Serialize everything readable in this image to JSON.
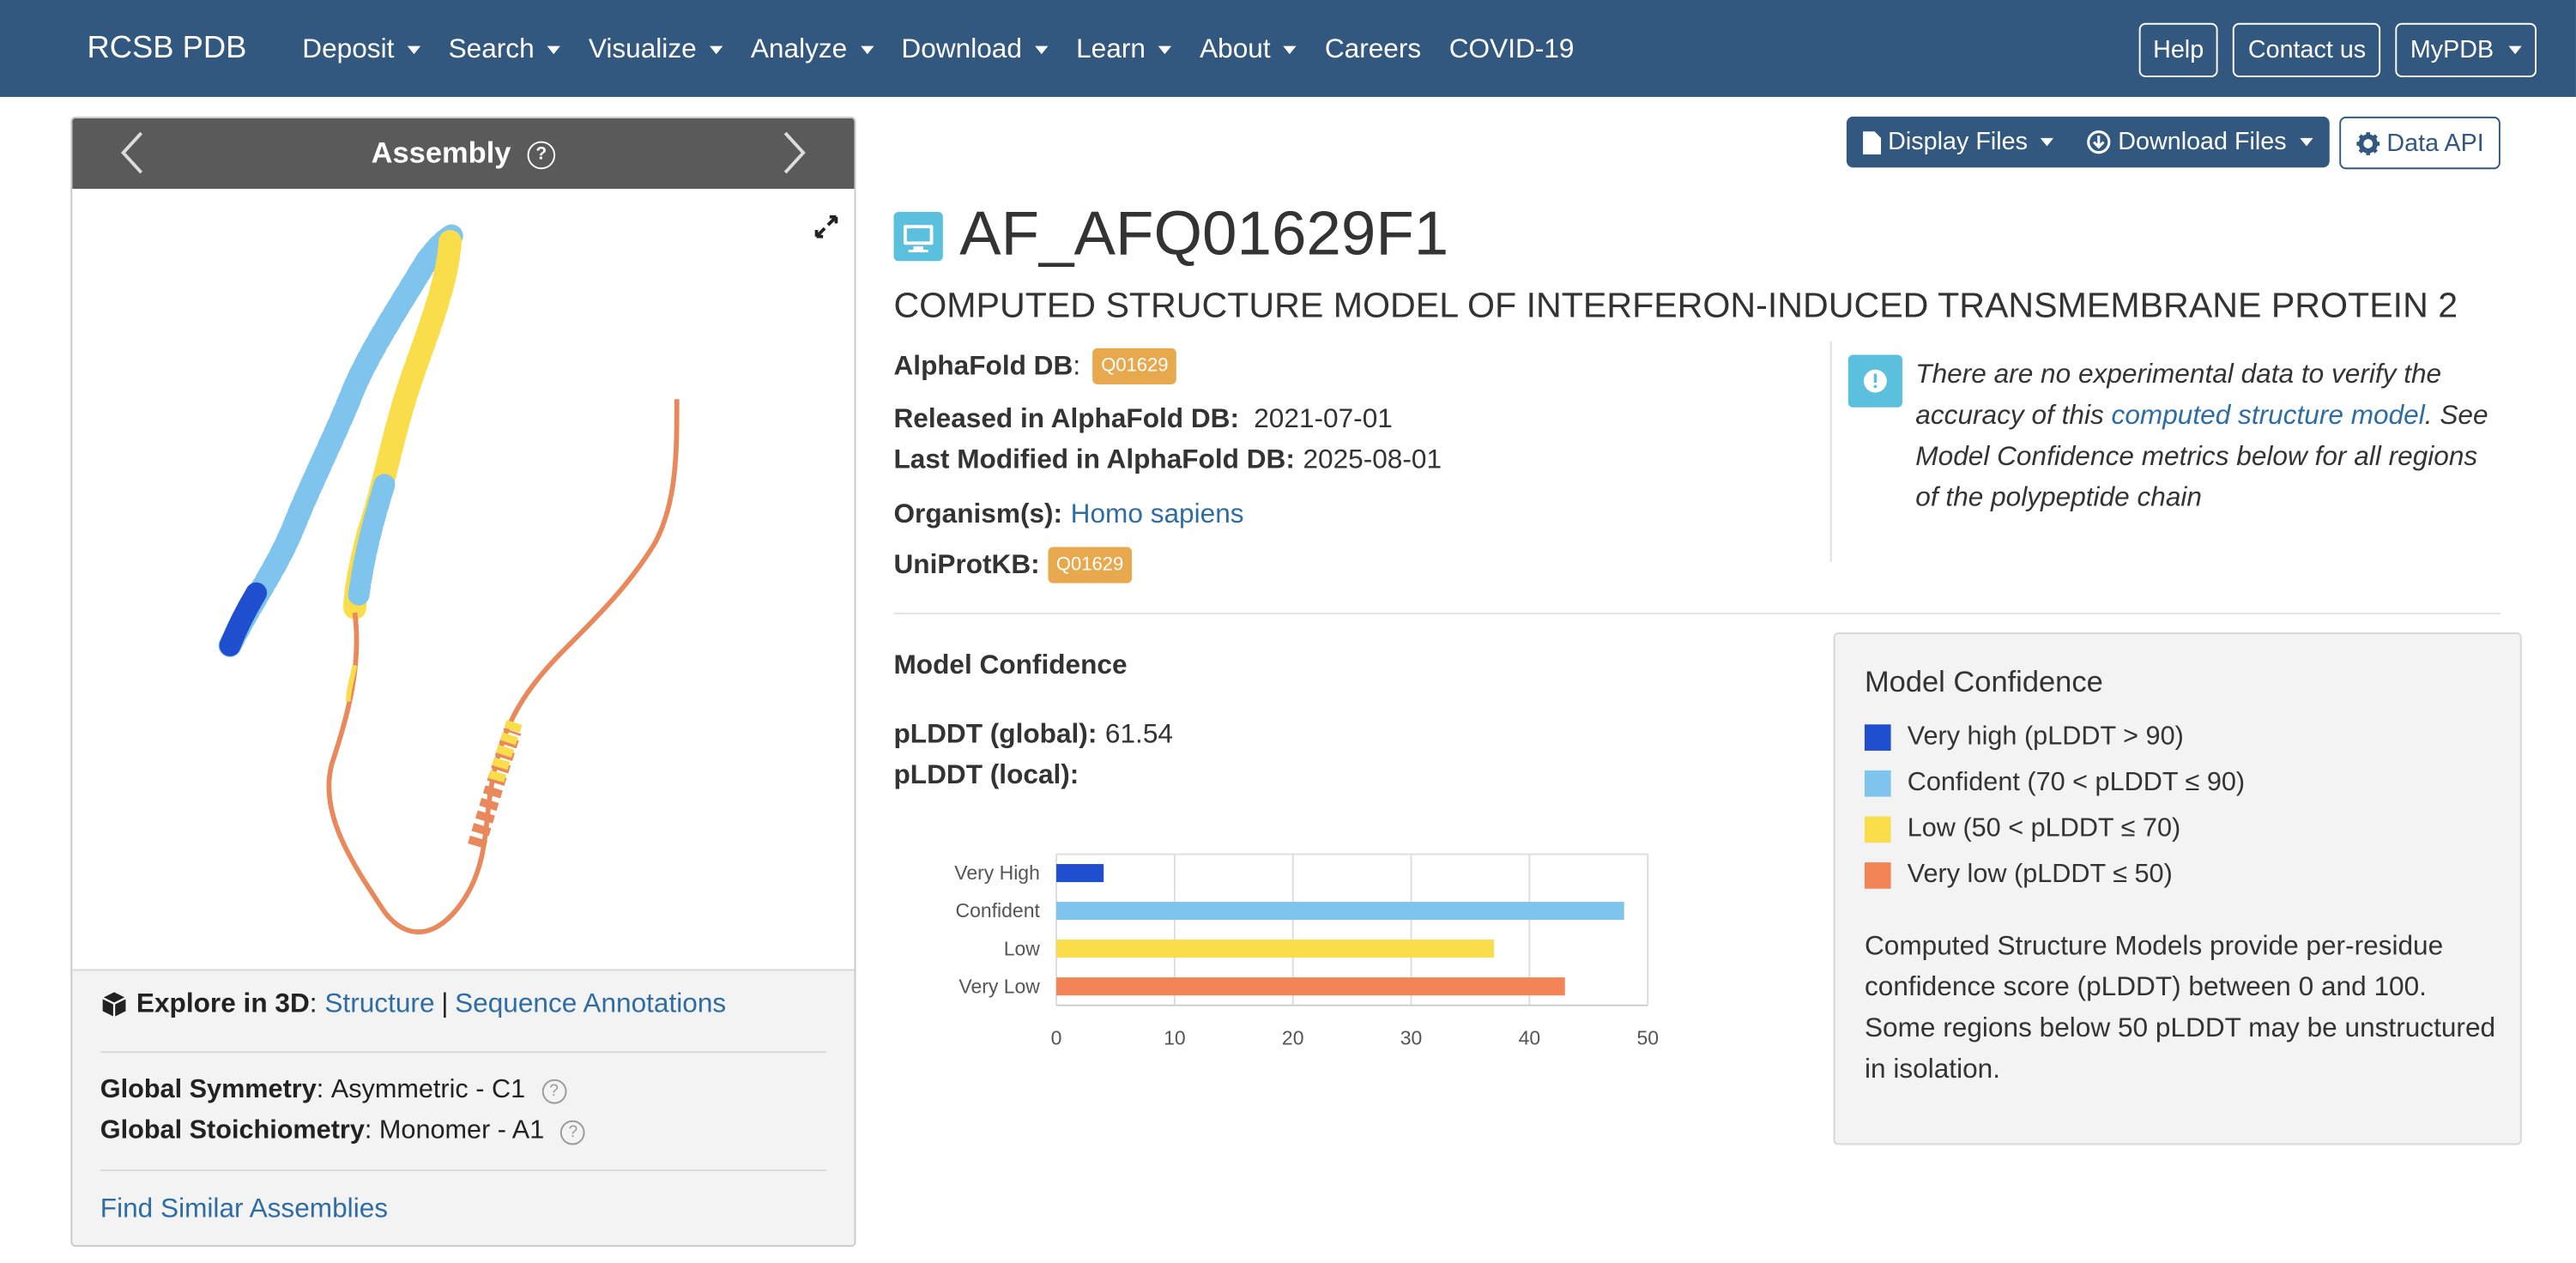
{
  "navbar": {
    "brand": "RCSB PDB",
    "items": [
      {
        "label": "Deposit",
        "dropdown": true
      },
      {
        "label": "Search",
        "dropdown": true
      },
      {
        "label": "Visualize",
        "dropdown": true
      },
      {
        "label": "Analyze",
        "dropdown": true
      },
      {
        "label": "Download",
        "dropdown": true
      },
      {
        "label": "Learn",
        "dropdown": true
      },
      {
        "label": "About",
        "dropdown": true
      },
      {
        "label": "Careers",
        "dropdown": false
      },
      {
        "label": "COVID-19",
        "dropdown": false
      }
    ],
    "right": {
      "help": "Help",
      "contact": "Contact us",
      "mypdb": "MyPDB"
    }
  },
  "assembly": {
    "title": "Assembly",
    "explore_label": "Explore in 3D",
    "structure_link": "Structure",
    "separator": "|",
    "sequence_link": "Sequence Annotations",
    "symmetry_label": "Global Symmetry",
    "symmetry_value": "Asymmetric - C1",
    "stoichiometry_label": "Global Stoichiometry",
    "stoichiometry_value": "Monomer - A1",
    "find_similar": "Find Similar Assemblies"
  },
  "toolbar": {
    "display_files": "Display Files",
    "download_files": "Download Files",
    "data_api": "Data API"
  },
  "entry": {
    "id": "AF_AFQ01629F1",
    "title": "COMPUTED STRUCTURE MODEL OF INTERFERON-INDUCED TRANSMEMBRANE PROTEIN 2",
    "alphafold_label": "AlphaFold DB",
    "alphafold_badge": "Q01629",
    "released_label": "Released in AlphaFold DB:",
    "released_value": "2021-07-01",
    "modified_label": "Last Modified in AlphaFold DB:",
    "modified_value": "2025-08-01",
    "organism_label": "Organism(s):",
    "organism_value": "Homo sapiens",
    "uniprot_label": "UniProtKB:",
    "uniprot_badge": "Q01629"
  },
  "notice": {
    "text_1": "There are no experimental data to verify the accuracy of this ",
    "link": "computed structure model",
    "text_2": ". See Model Confidence metrics below for all regions of the polypeptide chain"
  },
  "confidence": {
    "section_title": "Model Confidence",
    "global_label": "pLDDT (global):",
    "global_value": "61.54",
    "local_label": "pLDDT (local):"
  },
  "legend_box": {
    "title": "Model Confidence",
    "items": [
      {
        "label": "Very high (pLDDT > 90)",
        "color": "#1f4fcf"
      },
      {
        "label": "Confident (70 < pLDDT ≤ 90)",
        "color": "#7ec4ec"
      },
      {
        "label": "Low (50 < pLDDT ≤ 70)",
        "color": "#f9dd4a"
      },
      {
        "label": "Very low (pLDDT ≤ 50)",
        "color": "#f28455"
      }
    ],
    "description": "Computed Structure Models provide per-residue confidence score (pLDDT) between 0 and 100. Some regions below 50 pLDDT may be unstructured in isolation."
  },
  "chart_data": {
    "type": "bar",
    "orientation": "horizontal",
    "categories": [
      "Very High",
      "Confident",
      "Low",
      "Very Low"
    ],
    "values": [
      4,
      48,
      37,
      43
    ],
    "colors": [
      "#1f4fcf",
      "#7ec4ec",
      "#f9dd4a",
      "#f28455"
    ],
    "xlim": [
      0,
      50
    ],
    "xticks": [
      0,
      10,
      20,
      30,
      40,
      50
    ],
    "grid": true
  }
}
